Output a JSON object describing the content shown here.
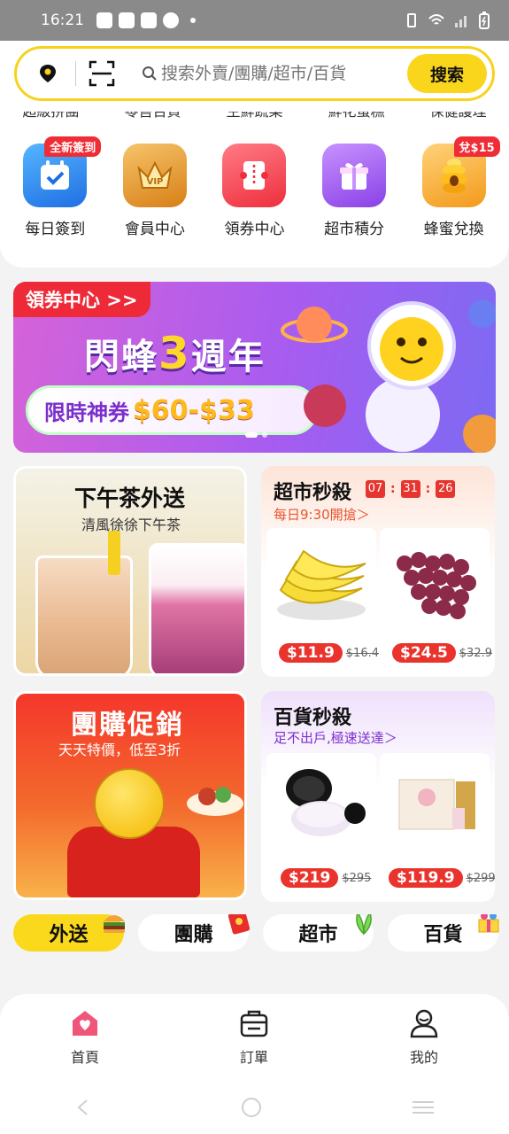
{
  "status_bar": {
    "time": "16:21"
  },
  "search": {
    "placeholder": "搜索外賣/團購/超市/百貨",
    "button_label": "搜索"
  },
  "quick_links_cut": [
    "超級拼團",
    "零售百貨",
    "生鮮蔬菜",
    "鮮花蛋糕",
    "保健護理"
  ],
  "quick_icons": [
    {
      "label": "每日簽到",
      "badge": "全新簽到",
      "icon": "calendar-check-icon",
      "color": "#2f8cf2"
    },
    {
      "label": "會員中心",
      "badge": "",
      "icon": "vip-crown-icon",
      "color": "#e69a2a"
    },
    {
      "label": "領券中心",
      "badge": "",
      "icon": "coupon-icon",
      "color": "#f0434f"
    },
    {
      "label": "超市積分",
      "badge": "",
      "icon": "gift-box-icon",
      "color": "#9a52ea"
    },
    {
      "label": "蜂蜜兌換",
      "badge": "兌$15",
      "icon": "beehive-icon",
      "color": "#f4a62a"
    }
  ],
  "banner": {
    "tag": "領券中心 >>",
    "title_pre": "閃蜂",
    "title_num": "3",
    "title_post": "週年",
    "deal_text": "限時神券",
    "deal_price": "$60-$33"
  },
  "tea_card": {
    "title": "下午茶外送",
    "subtitle": "清風徐徐下午茶"
  },
  "market_flash": {
    "title": "超市秒殺",
    "countdown": [
      "07",
      "31",
      "26"
    ],
    "subtitle": "每日9:30開搶＞",
    "products": [
      {
        "name": "banana",
        "price": "$11.9",
        "original": "$16.4"
      },
      {
        "name": "grape",
        "price": "$24.5",
        "original": "$32.9"
      }
    ]
  },
  "group_card": {
    "title": "團購促銷",
    "subtitle": "天天特價，低至3折"
  },
  "dept_flash": {
    "title": "百貨秒殺",
    "subtitle": "足不出戶,極速送達＞",
    "products": [
      {
        "name": "loose powder",
        "price": "$219",
        "original": "$295"
      },
      {
        "name": "skincare set",
        "price": "$119.9",
        "original": "$299"
      }
    ]
  },
  "category_tabs": [
    {
      "label": "外送",
      "active": true
    },
    {
      "label": "團購",
      "active": false
    },
    {
      "label": "超市",
      "active": false
    },
    {
      "label": "百貨",
      "active": false
    }
  ],
  "bottom_nav": [
    {
      "label": "首頁",
      "icon": "home-icon"
    },
    {
      "label": "訂單",
      "icon": "orders-icon"
    },
    {
      "label": "我的",
      "icon": "profile-icon"
    }
  ]
}
